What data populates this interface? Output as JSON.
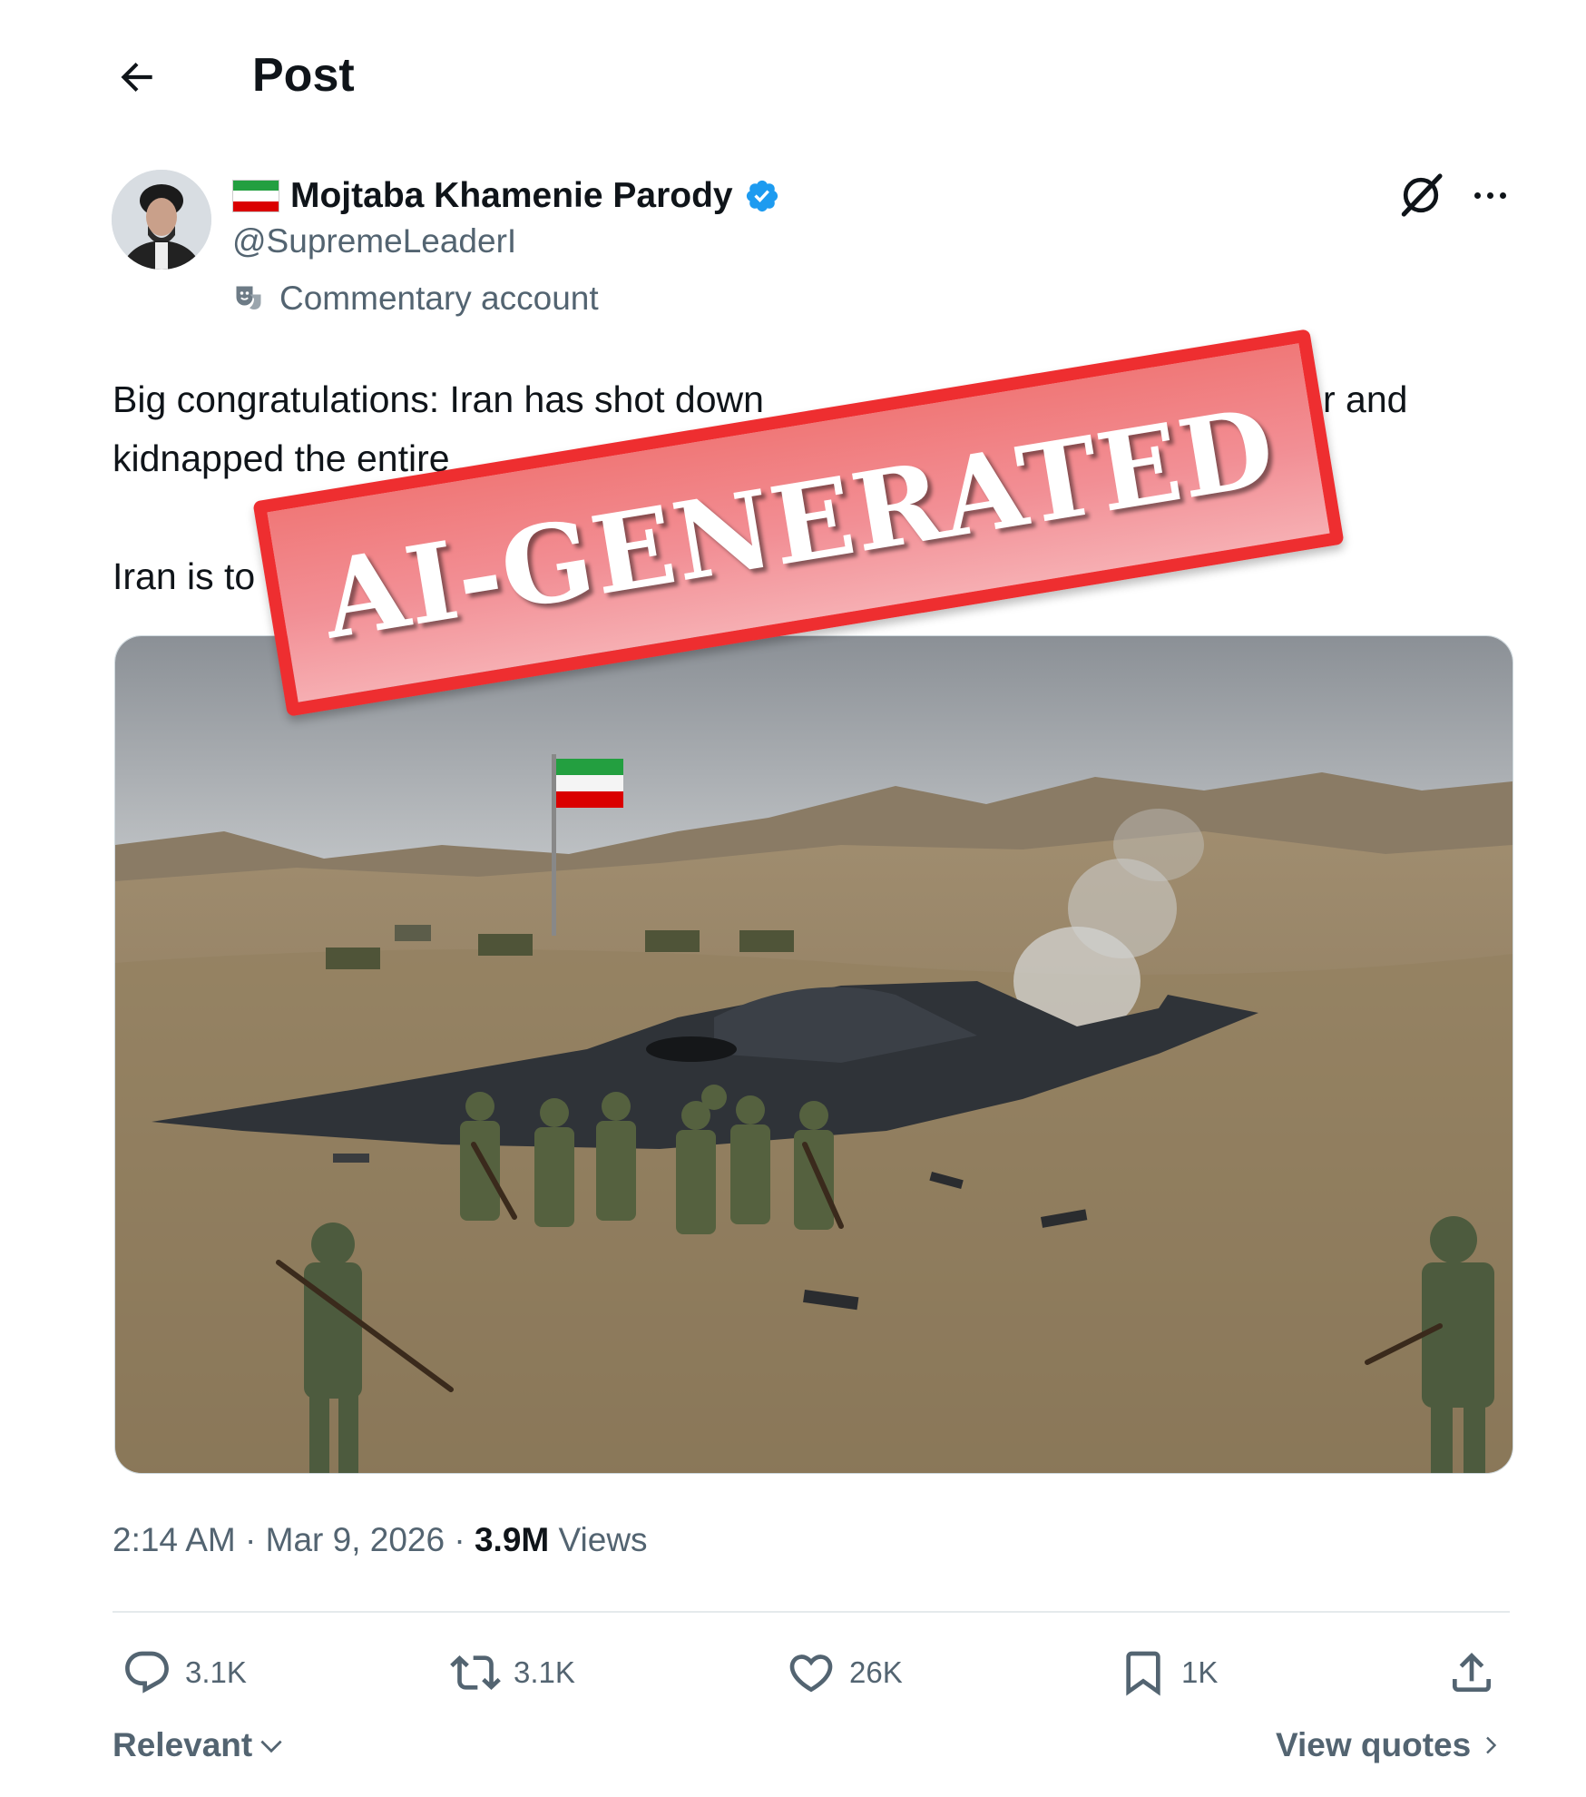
{
  "header": {
    "title": "Post"
  },
  "author": {
    "display_name": "Mojtaba Khamenie Parody",
    "handle": "@SupremeLeaderI",
    "label": "Commentary account"
  },
  "post": {
    "lines": [
      "Big congratulations: Iran has shot down",
      "r and",
      "kidnapped the entire",
      "Iran is to"
    ],
    "timestamp": "2:14 AM · Mar 9, 2026 · ",
    "views_count": "3.9M",
    "views_label": " Views"
  },
  "actions": {
    "replies": "3.1K",
    "reposts": "3.1K",
    "likes": "26K",
    "bookmarks": "1K"
  },
  "footer": {
    "sort_label": "Relevant",
    "view_quotes": "View quotes"
  },
  "overlay": {
    "stamp_text": "AI-GENERATED"
  },
  "colors": {
    "text": "#0f1419",
    "secondary": "#536471",
    "verified_blue": "#1d9bf0",
    "stamp_red": "#ee2e30"
  }
}
